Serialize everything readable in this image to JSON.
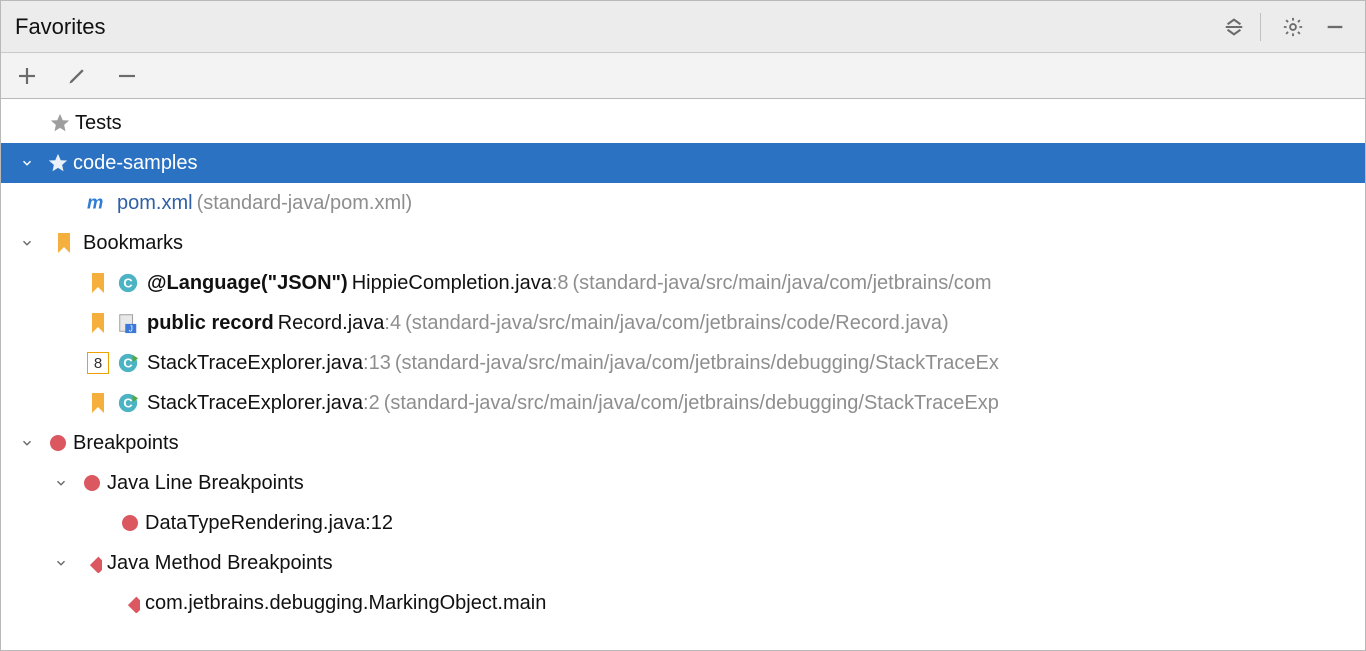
{
  "header": {
    "title": "Favorites"
  },
  "tree": {
    "tests_label": "Tests",
    "code_samples_label": "code-samples",
    "pom": {
      "name": "pom.xml",
      "hint": "(standard-java/pom.xml)"
    },
    "bookmarks_label": "Bookmarks",
    "bm1": {
      "bold": "@Language(\"JSON\")",
      "file": "HippieCompletion.java",
      "line": ":8",
      "path": "(standard-java/src/main/java/com/jetbrains/com"
    },
    "bm2": {
      "bold": "public record",
      "file": "Record.java",
      "line": ":4",
      "path": "(standard-java/src/main/java/com/jetbrains/code/Record.java)"
    },
    "bm3": {
      "num": "8",
      "file": "StackTraceExplorer.java",
      "line": ":13",
      "path": "(standard-java/src/main/java/com/jetbrains/debugging/StackTraceEx"
    },
    "bm4": {
      "file": "StackTraceExplorer.java",
      "line": ":2",
      "path": "(standard-java/src/main/java/com/jetbrains/debugging/StackTraceExp"
    },
    "breakpoints_label": "Breakpoints",
    "line_bp_label": "Java Line Breakpoints",
    "line_bp_item": "DataTypeRendering.java:12",
    "method_bp_label": "Java Method Breakpoints",
    "method_bp_item": "com.jetbrains.debugging.MarkingObject.main"
  }
}
